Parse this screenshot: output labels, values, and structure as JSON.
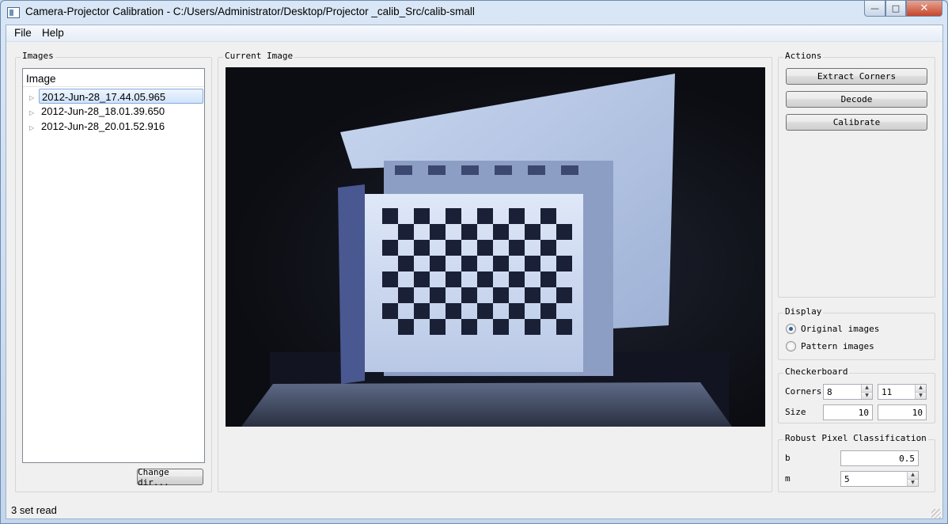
{
  "window": {
    "title": "Camera-Projector Calibration - C:/Users/Administrator/Desktop/Projector _calib_Src/calib-small",
    "minimize_glyph": "—",
    "maximize_glyph": "□",
    "close_glyph": "✕"
  },
  "menu": {
    "file": "File",
    "help": "Help"
  },
  "images_panel": {
    "title": "Images",
    "column_header": "Image",
    "items": [
      {
        "label": "2012-Jun-28_17.44.05.965",
        "selected": true
      },
      {
        "label": "2012-Jun-28_18.01.39.650",
        "selected": false
      },
      {
        "label": "2012-Jun-28_20.01.52.916",
        "selected": false
      }
    ],
    "expand_glyph": "▷",
    "change_dir_label": "Change dir..."
  },
  "current_image": {
    "title": "Current Image"
  },
  "actions": {
    "title": "Actions",
    "extract_corners": "Extract Corners",
    "decode": "Decode",
    "calibrate": "Calibrate"
  },
  "display": {
    "title": "Display",
    "original_images": "Original images",
    "pattern_images": "Pattern images",
    "selected": "original"
  },
  "checkerboard": {
    "title": "Checkerboard",
    "corners_label": "Corners",
    "corners_x": "8",
    "corners_y": "11",
    "size_label": "Size",
    "size_x": "10",
    "size_y": "10"
  },
  "robust": {
    "title": "Robust Pixel Classification",
    "b_label": "b",
    "b_value": "0.5",
    "m_label": "m",
    "m_value": "5"
  },
  "spin": {
    "up": "▲",
    "down": "▼"
  },
  "status": {
    "text": "3 set read"
  },
  "colors": {
    "title_bar": "#c9d8ea",
    "close_button": "#c6452c",
    "selection": "#cfe3fb",
    "projected_light": "#b8c8e6",
    "checker_dark": "#1a2036"
  }
}
